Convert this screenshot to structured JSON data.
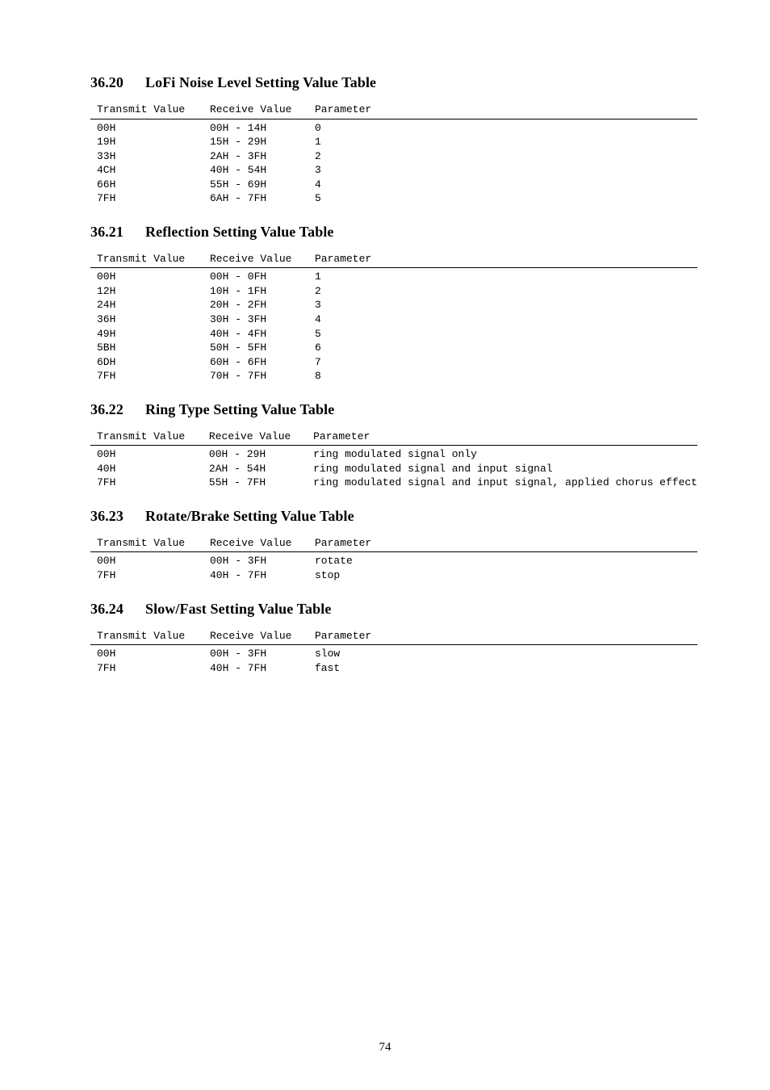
{
  "page_number": "74",
  "headers": {
    "transmit": "Transmit Value",
    "receive": "Receive Value",
    "parameter": "Parameter"
  },
  "sections": [
    {
      "num": "36.20",
      "title": "LoFi Noise Level Setting Value Table",
      "rows": [
        {
          "tx": "00H",
          "rx": "00H - 14H",
          "pm": "0"
        },
        {
          "tx": "19H",
          "rx": "15H - 29H",
          "pm": "1"
        },
        {
          "tx": "33H",
          "rx": "2AH - 3FH",
          "pm": "2"
        },
        {
          "tx": "4CH",
          "rx": "40H - 54H",
          "pm": "3"
        },
        {
          "tx": "66H",
          "rx": "55H - 69H",
          "pm": "4"
        },
        {
          "tx": "7FH",
          "rx": "6AH - 7FH",
          "pm": "5"
        }
      ]
    },
    {
      "num": "36.21",
      "title": "Reflection Setting Value Table",
      "rows": [
        {
          "tx": "00H",
          "rx": "00H - 0FH",
          "pm": "1"
        },
        {
          "tx": "12H",
          "rx": "10H - 1FH",
          "pm": "2"
        },
        {
          "tx": "24H",
          "rx": "20H - 2FH",
          "pm": "3"
        },
        {
          "tx": "36H",
          "rx": "30H - 3FH",
          "pm": "4"
        },
        {
          "tx": "49H",
          "rx": "40H - 4FH",
          "pm": "5"
        },
        {
          "tx": "5BH",
          "rx": "50H - 5FH",
          "pm": "6"
        },
        {
          "tx": "6DH",
          "rx": "60H - 6FH",
          "pm": "7"
        },
        {
          "tx": "7FH",
          "rx": "70H - 7FH",
          "pm": "8"
        }
      ]
    },
    {
      "num": "36.22",
      "title": "Ring Type Setting Value Table",
      "rows": [
        {
          "tx": "00H",
          "rx": "00H - 29H",
          "pm": "ring modulated signal only"
        },
        {
          "tx": "40H",
          "rx": "2AH - 54H",
          "pm": "ring modulated signal and input signal"
        },
        {
          "tx": "7FH",
          "rx": "55H - 7FH",
          "pm": "ring modulated signal and input signal, applied chorus effect"
        }
      ]
    },
    {
      "num": "36.23",
      "title": "Rotate/Brake Setting Value Table",
      "rows": [
        {
          "tx": "00H",
          "rx": "00H - 3FH",
          "pm": "rotate"
        },
        {
          "tx": "7FH",
          "rx": "40H - 7FH",
          "pm": "stop"
        }
      ]
    },
    {
      "num": "36.24",
      "title": "Slow/Fast Setting Value Table",
      "rows": [
        {
          "tx": "00H",
          "rx": "00H - 3FH",
          "pm": "slow"
        },
        {
          "tx": "7FH",
          "rx": "40H - 7FH",
          "pm": "fast"
        }
      ]
    }
  ]
}
